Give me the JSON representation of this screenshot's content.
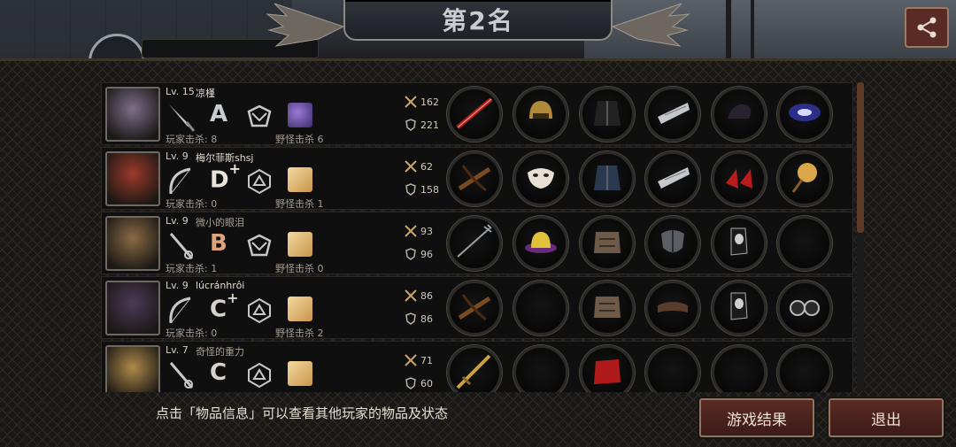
{
  "header": {
    "rank_title": "第2名",
    "share_icon": "share-icon"
  },
  "players": [
    {
      "level": "Lv. 15",
      "name": "凉槿",
      "name_dim": false,
      "grade": "A",
      "grade_sup": "",
      "weapon": "knife-icon",
      "class": "shield-class-icon",
      "skill": "purple-beast-icon",
      "player_kills": "玩家击杀: 8",
      "monster_kills": "野怪击杀 6",
      "atk": "162",
      "def": "221",
      "portrait_color": "#7d6f8c",
      "items": [
        "red-spear-icon",
        "gold-helmet-icon",
        "dark-armor-icon",
        "silver-gauntlet-icon",
        "dark-gloves-icon",
        "galaxy-orb-icon"
      ]
    },
    {
      "level": "Lv. 9",
      "name": "梅尔菲斯shsj",
      "name_dim": false,
      "grade": "D",
      "grade_sup": "+",
      "weapon": "bow-icon",
      "class": "hex-class-icon",
      "skill": "gold-scroll-icon",
      "player_kills": "玩家击杀: 0",
      "monster_kills": "野怪击杀 1",
      "atk": "62",
      "def": "158",
      "portrait_color": "#9b3a2a",
      "items": [
        "crossbow-icon",
        "white-mask-icon",
        "blue-coat-icon",
        "silver-gauntlet-icon",
        "red-heels-icon",
        "gold-rattle-icon"
      ]
    },
    {
      "level": "Lv. 9",
      "name": "微小的眼泪",
      "name_dim": true,
      "grade": "B",
      "grade_sup": "",
      "weapon": "sword-icon",
      "class": "shield-class-icon",
      "skill": "gold-scroll-icon",
      "player_kills": "玩家击杀: 1",
      "monster_kills": "野怪击杀 0",
      "atk": "93",
      "def": "96",
      "portrait_color": "#8a6a45",
      "items": [
        "trident-icon",
        "purple-hat-icon",
        "leather-armor-icon",
        "iron-shield-icon",
        "black-boots-icon",
        "empty-slot"
      ]
    },
    {
      "level": "Lv. 9",
      "name": "lúcránhrôi",
      "name_dim": false,
      "grade": "C",
      "grade_sup": "+",
      "weapon": "bow-icon",
      "class": "hex-class-icon",
      "skill": "gold-scroll-icon",
      "player_kills": "玩家击杀: 0",
      "monster_kills": "野怪击杀 2",
      "atk": "86",
      "def": "86",
      "portrait_color": "#4b3a5a",
      "items": [
        "crossbow-icon",
        "empty-slot",
        "leather-armor-icon",
        "leather-bracer-icon",
        "black-boots-icon",
        "binoculars-icon"
      ]
    },
    {
      "level": "Lv. 7",
      "name": "奇怪的重力",
      "name_dim": true,
      "grade": "C",
      "grade_sup": "",
      "weapon": "sword-icon",
      "class": "hex-class-icon",
      "skill": "gold-scroll-icon",
      "player_kills": "",
      "monster_kills": "",
      "atk": "71",
      "def": "60",
      "portrait_color": "#b08a4a",
      "items": [
        "gold-sword-icon",
        "empty-slot",
        "red-cloth-icon",
        "empty-slot",
        "empty-slot",
        "empty-slot"
      ]
    }
  ],
  "footer": {
    "hint": "点击「物品信息」可以查看其他玩家的物品及状态",
    "result_button": "游戏结果",
    "exit_button": "退出"
  },
  "colors": {
    "accent_red": "#5a2a24",
    "frame_gold": "#8e7660"
  }
}
